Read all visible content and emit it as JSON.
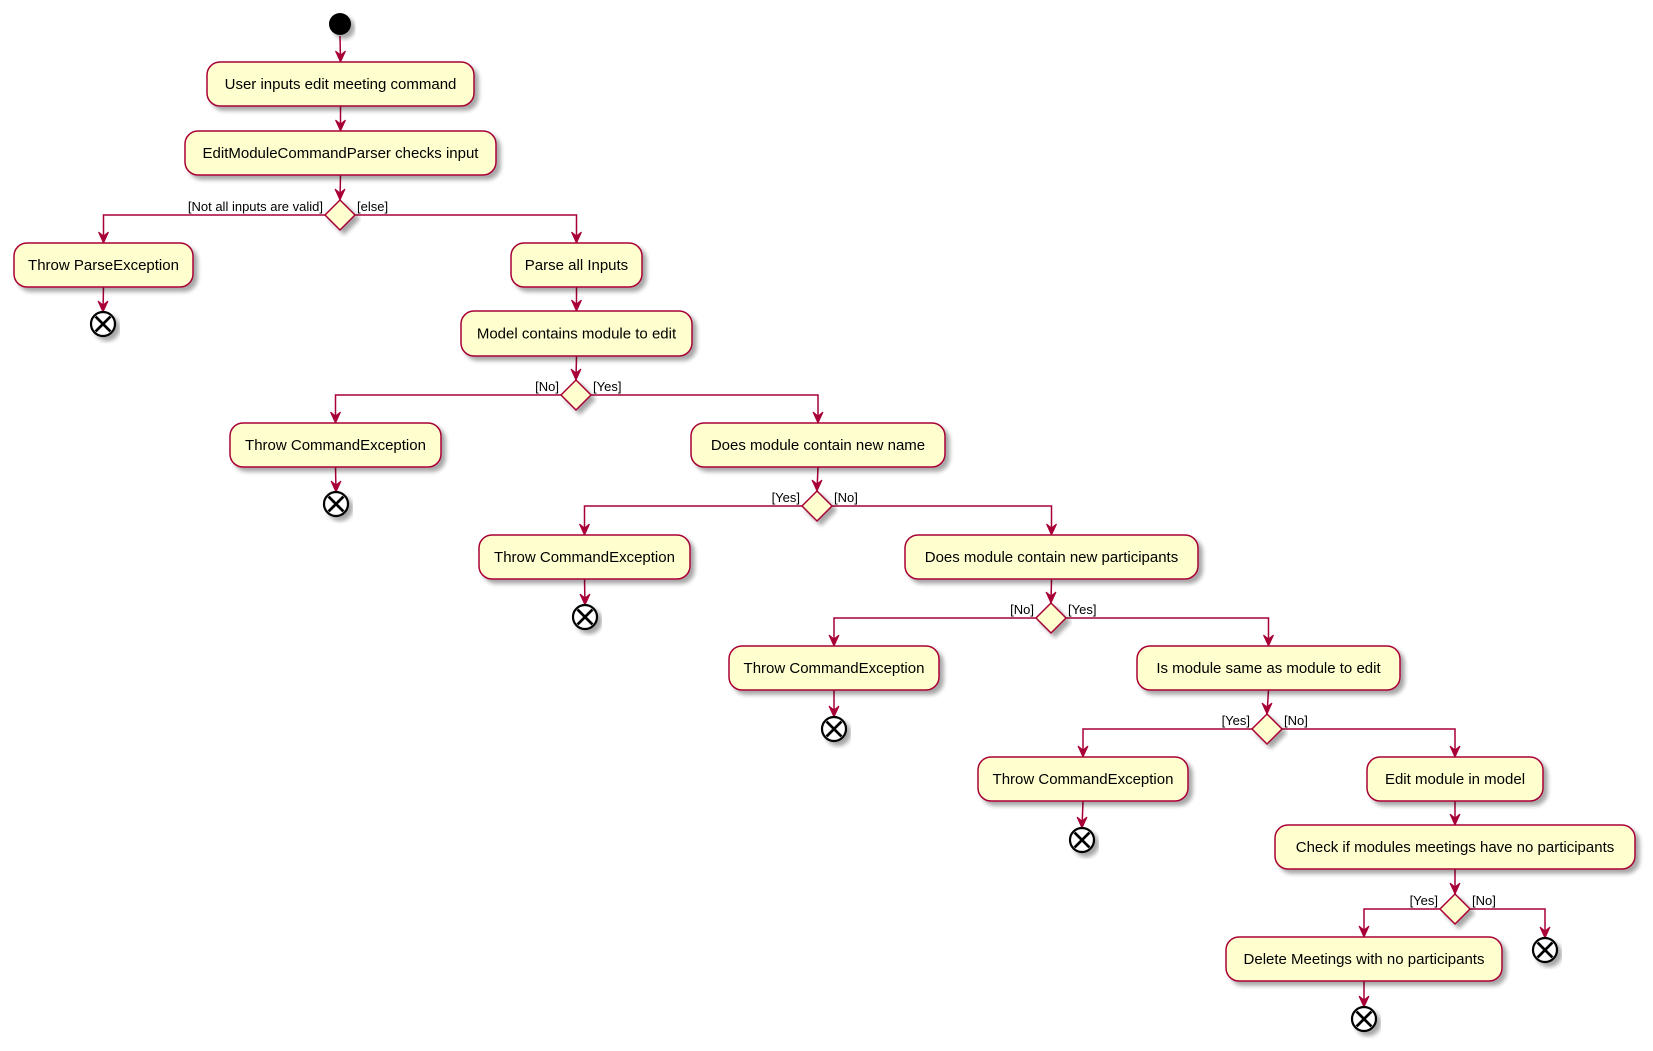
{
  "diagram": {
    "type": "uml-activity",
    "colors": {
      "stroke": "#A80036",
      "fill": "#FEFECE",
      "text": "#000000",
      "terminal": "#000000",
      "shadow": "#B8B8B8"
    },
    "start": "start",
    "activities": {
      "a1": "User inputs edit meeting command",
      "a2": "EditModuleCommandParser checks input",
      "a3": "Throw ParseException",
      "a4": "Parse all Inputs",
      "a5": "Model contains module to edit",
      "a6": "Throw CommandException",
      "a7": "Does module contain new name",
      "a8": "Throw CommandException",
      "a9": "Does module contain new participants",
      "a10": "Throw CommandException",
      "a11": "Is module same as module to edit",
      "a12": "Throw CommandException",
      "a13": "Edit module in model",
      "a14": "Check if modules meetings have no participants",
      "a15": "Delete Meetings with no participants"
    },
    "decisions": {
      "d1": {
        "left": "[Not all inputs are valid]",
        "right": "[else]"
      },
      "d2": {
        "left": "[No]",
        "right": "[Yes]"
      },
      "d3": {
        "left": "[Yes]",
        "right": "[No]"
      },
      "d4": {
        "left": "[No]",
        "right": "[Yes]"
      },
      "d5": {
        "left": "[Yes]",
        "right": "[No]"
      },
      "d6": {
        "left": "[Yes]",
        "right": "[No]"
      }
    },
    "flows": [
      [
        "start",
        "a1"
      ],
      [
        "a1",
        "a2"
      ],
      [
        "a2",
        "d1"
      ],
      [
        "d1",
        "a3",
        "left"
      ],
      [
        "d1",
        "a4",
        "right"
      ],
      [
        "a3",
        "e1"
      ],
      [
        "a4",
        "a5"
      ],
      [
        "a5",
        "d2"
      ],
      [
        "d2",
        "a6",
        "left"
      ],
      [
        "d2",
        "a7",
        "right"
      ],
      [
        "a6",
        "e2"
      ],
      [
        "a7",
        "d3"
      ],
      [
        "d3",
        "a8",
        "left"
      ],
      [
        "d3",
        "a9",
        "right"
      ],
      [
        "a8",
        "e3"
      ],
      [
        "a9",
        "d4"
      ],
      [
        "d4",
        "a10",
        "left"
      ],
      [
        "d4",
        "a11",
        "right"
      ],
      [
        "a10",
        "e4"
      ],
      [
        "a11",
        "d5"
      ],
      [
        "d5",
        "a12",
        "left"
      ],
      [
        "d5",
        "a13",
        "right"
      ],
      [
        "a12",
        "e5"
      ],
      [
        "a13",
        "a14"
      ],
      [
        "a14",
        "d6"
      ],
      [
        "d6",
        "a15",
        "left"
      ],
      [
        "d6",
        "e6",
        "right"
      ],
      [
        "a15",
        "e7"
      ]
    ],
    "ends": [
      "e1",
      "e2",
      "e3",
      "e4",
      "e5",
      "e6",
      "e7"
    ]
  }
}
